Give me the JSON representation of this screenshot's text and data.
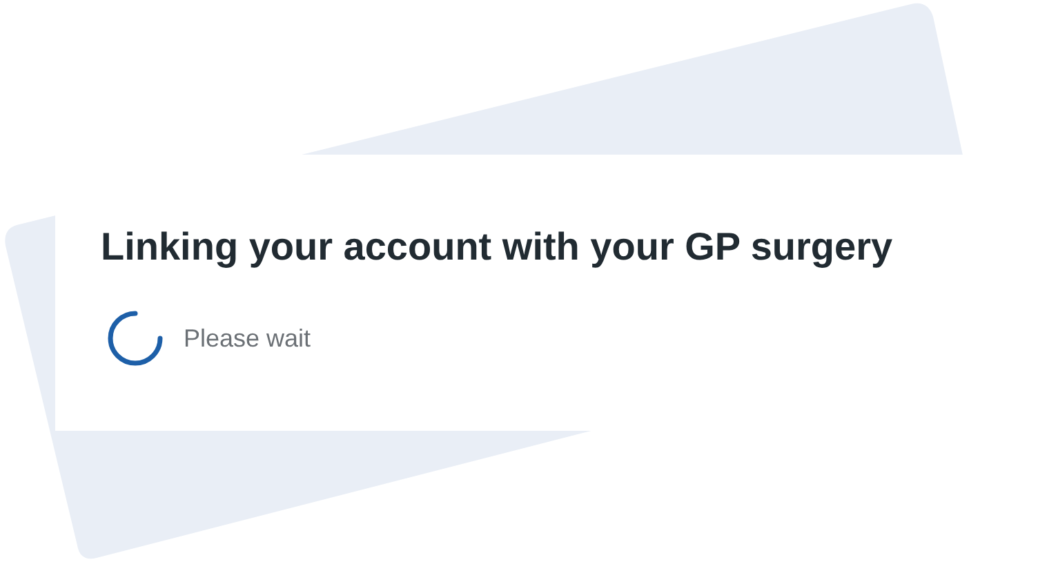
{
  "card": {
    "title": "Linking your account with your GP surgery",
    "status": "Please wait"
  }
}
